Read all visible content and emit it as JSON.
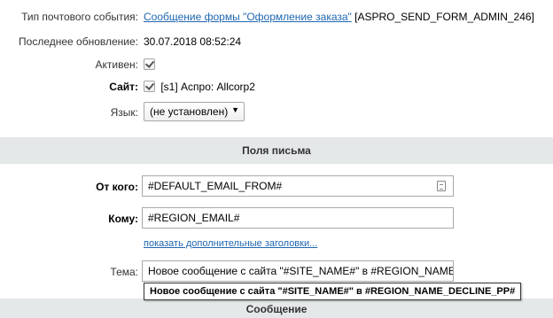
{
  "fields": {
    "event_type_label": "Тип почтового события:",
    "event_type_link": "Сообщение формы \"Оформление заказа\"",
    "event_type_code": "[ASPRO_SEND_FORM_ADMIN_246]",
    "updated_label": "Последнее обновление:",
    "updated_value": "30.07.2018 08:52:24",
    "active_label": "Активен:",
    "site_label": "Сайт:",
    "site_value": "[s1] Аспро: Allcorp2",
    "lang_label": "Язык:",
    "lang_value": "(не установлен)"
  },
  "sections": {
    "letter_fields": "Поля письма",
    "message": "Сообщение"
  },
  "letter": {
    "from_label": "От кого:",
    "from_value": "#DEFAULT_EMAIL_FROM#",
    "to_label": "Кому:",
    "to_value": "#REGION_EMAIL#",
    "extra_headers_link": "показать дополнительные заголовки...",
    "subject_label": "Тема:",
    "subject_value": "Новое сообщение с сайта \"#SITE_NAME#\" в #REGION_NAME_",
    "subject_tooltip": "Новое сообщение с сайта \"#SITE_NAME#\" в #REGION_NAME_DECLINE_PP#"
  },
  "icons": {
    "select_arrow": "▼",
    "from_field_icon": "document-icon"
  },
  "colors": {
    "link": "#2067b0",
    "section_bg": "#e4e8e9"
  }
}
